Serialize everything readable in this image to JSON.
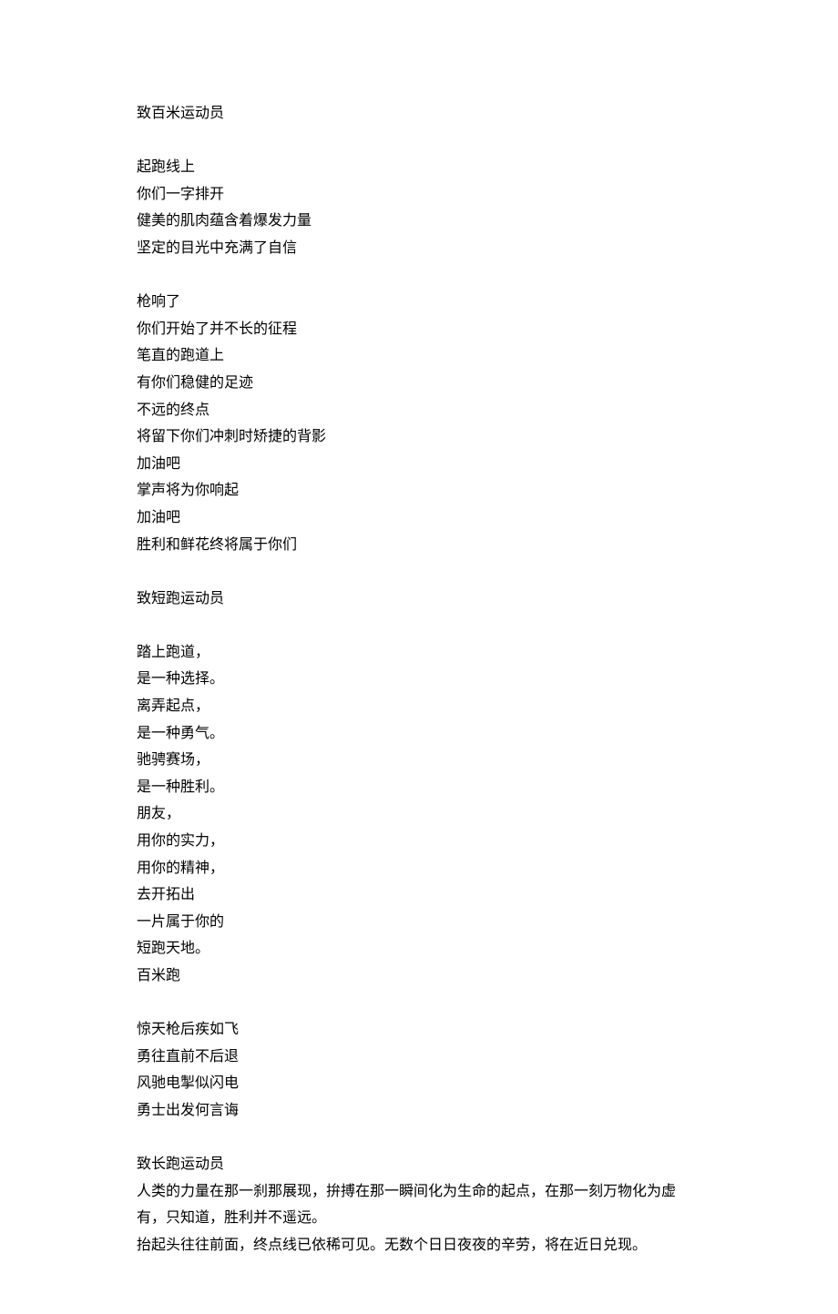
{
  "sections": [
    {
      "title": "致百米运动员",
      "blocks": [
        [
          "起跑线上",
          "你们一字排开",
          "健美的肌肉蕴含着爆发力量",
          "坚定的目光中充满了自信"
        ],
        [
          "枪响了",
          "你们开始了并不长的征程",
          "笔直的跑道上",
          "有你们稳健的足迹",
          "不远的终点",
          "将留下你们冲刺时矫捷的背影",
          "加油吧",
          "掌声将为你响起",
          "加油吧",
          "胜利和鲜花终将属于你们"
        ]
      ]
    },
    {
      "title": "致短跑运动员",
      "blocks": [
        [
          "踏上跑道，",
          "是一种选择。",
          "离弄起点，",
          "是一种勇气。",
          "驰骋赛场，",
          "是一种胜利。",
          "朋友，",
          "用你的实力，",
          "用你的精神，",
          "去开拓出",
          "一片属于你的",
          "短跑天地。",
          "百米跑"
        ],
        [
          "惊天枪后疾如飞",
          "勇往直前不后退",
          "风驰电掣似闪电",
          "勇士出发何言诲"
        ]
      ]
    },
    {
      "title": "致长跑运动员",
      "blocks": [
        [
          "人类的力量在那一刹那展现，拚搏在那一瞬间化为生命的起点，在那一刻万物化为虚有，只知道，胜利并不遥远。",
          "抬起头往往前面，终点线已依稀可见。无数个日日夜夜的辛劳，将在近日兑现。"
        ]
      ]
    }
  ]
}
